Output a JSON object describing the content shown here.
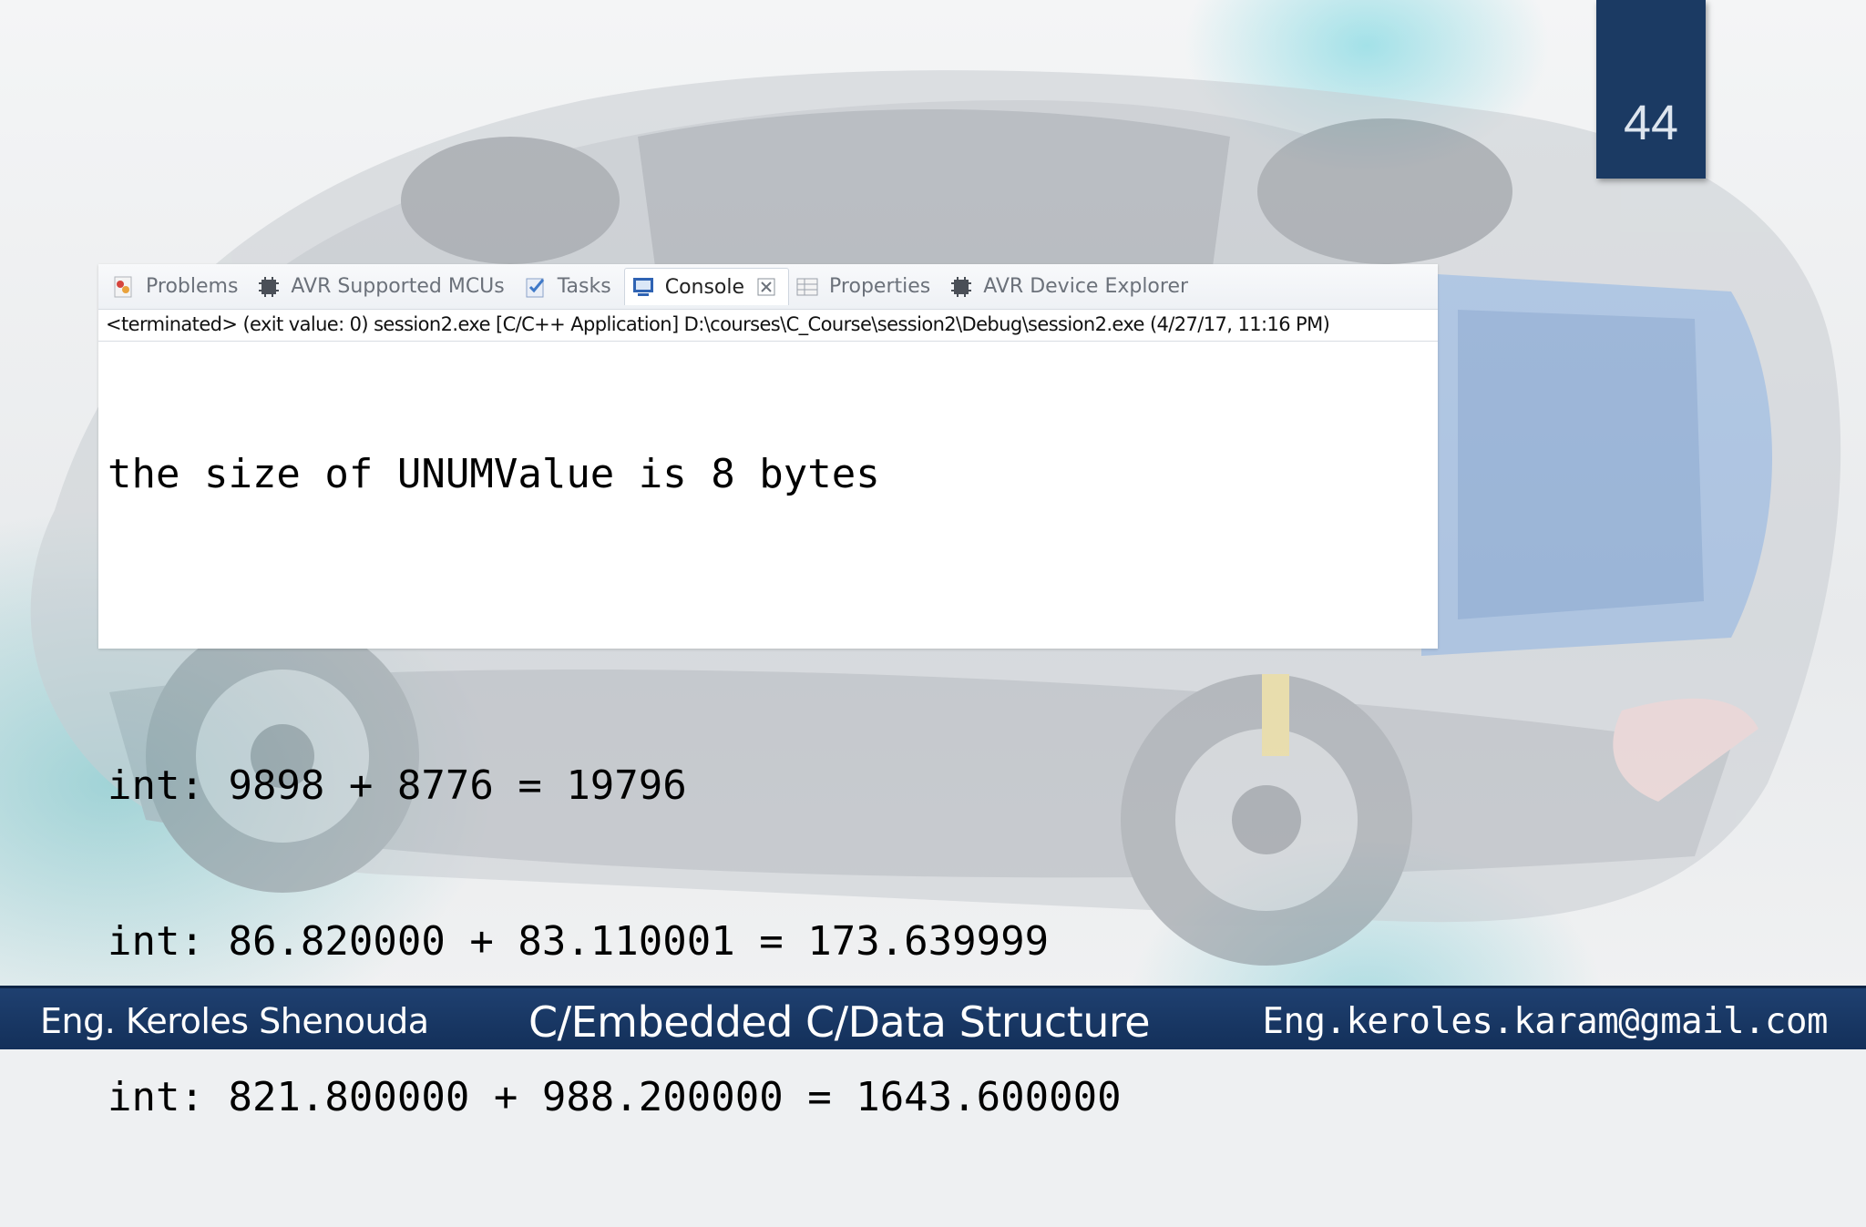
{
  "slide": {
    "number": "44",
    "accent_color": "#1b3a63",
    "footer_color": "#1a3965"
  },
  "eclipse": {
    "tabs": [
      {
        "label": "Problems",
        "icon": "problems-icon",
        "active": false
      },
      {
        "label": "AVR Supported MCUs",
        "icon": "chip-icon",
        "active": false
      },
      {
        "label": "Tasks",
        "icon": "tasks-icon",
        "active": false
      },
      {
        "label": "Console",
        "icon": "console-icon",
        "active": true,
        "close_icon": "close-icon"
      },
      {
        "label": "Properties",
        "icon": "properties-icon",
        "active": false
      },
      {
        "label": "AVR Device Explorer",
        "icon": "chip-icon",
        "active": false
      }
    ],
    "status_line": "<terminated> (exit value: 0) session2.exe [C/C++ Application] D:\\courses\\C_Course\\session2\\Debug\\session2.exe (4/27/17, 11:16 PM)",
    "console_lines": [
      "the size of UNUMValue is 8 bytes",
      "",
      "int: 9898 + 8776 = 19796",
      "int: 86.820000 + 83.110001 = 173.639999",
      "int: 821.800000 + 988.200000 = 1643.600000"
    ]
  },
  "footer": {
    "author": "Eng. Keroles Shenouda",
    "course": "C/Embedded C/Data Structure",
    "email": "Eng.keroles.karam@gmail.com"
  }
}
